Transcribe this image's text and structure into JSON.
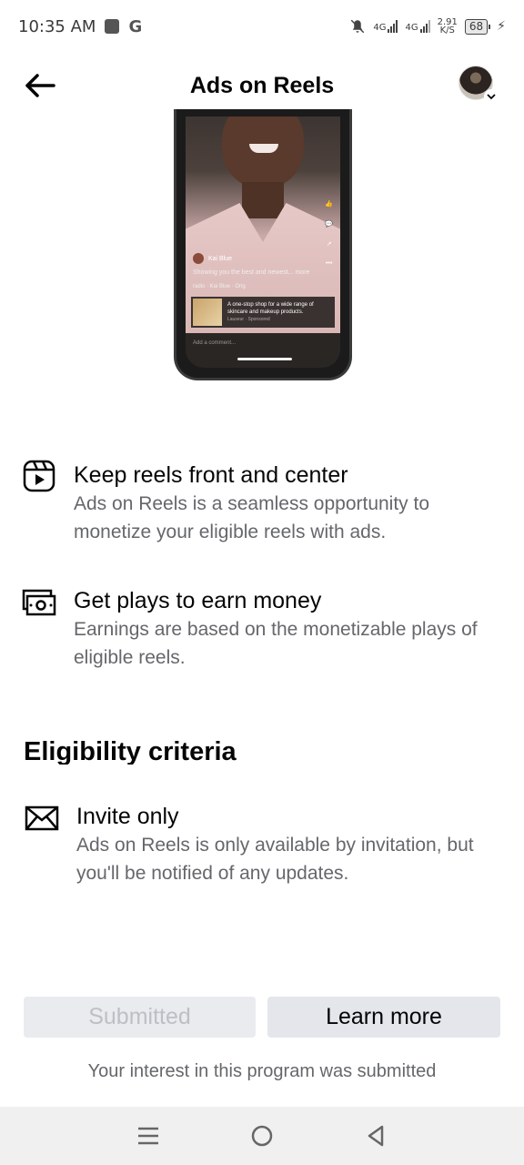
{
  "status_bar": {
    "time": "10:35 AM",
    "g_label": "G",
    "net1": "4G",
    "net2": "4G",
    "speed_value": "2.91",
    "speed_unit": "K/S",
    "battery": "68"
  },
  "header": {
    "title": "Ads on Reels",
    "back_icon": "arrow-left-icon",
    "avatar_icon": "profile-avatar"
  },
  "phone_preview": {
    "user_name": "Kai Blue",
    "caption": "Showing you the best and newest... more",
    "music": "radio · Kai Blue · Orig",
    "ad_text": "A one-stop shop for a wide range of skincare and makeup products.",
    "ad_sponsor": "Lauseur · Sponsored",
    "comment_placeholder": "Add a comment..."
  },
  "features": [
    {
      "icon": "reels-icon",
      "title": "Keep reels front and center",
      "description": "Ads on Reels is a seamless opportunity to monetize your eligible reels with ads."
    },
    {
      "icon": "money-icon",
      "title": "Get plays to earn money",
      "description": "Earnings are based on the monetizable plays of eligible reels."
    }
  ],
  "eligibility": {
    "heading": "Eligibility criteria",
    "items": [
      {
        "icon": "envelope-icon",
        "title": "Invite only",
        "description": "Ads on Reels is only available by invitation, but you'll be notified of any updates."
      }
    ]
  },
  "actions": {
    "submitted_label": "Submitted",
    "learn_more_label": "Learn more",
    "note": "Your interest in this program was submitted"
  },
  "nav_bar": {
    "items": [
      "menu-icon",
      "home-circle-icon",
      "back-triangle-icon"
    ]
  }
}
